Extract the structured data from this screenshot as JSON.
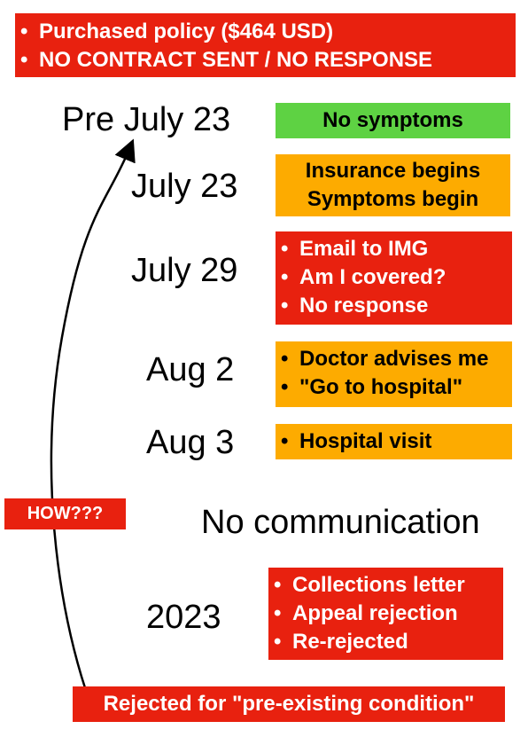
{
  "header_box": {
    "items": [
      "Purchased policy ($464 USD)",
      "NO CONTRACT SENT / NO RESPONSE"
    ]
  },
  "timeline": [
    {
      "date": "Pre July 23",
      "lines": [
        "No symptoms"
      ],
      "bullets": false,
      "color": "#5ed243"
    },
    {
      "date": "July 23",
      "lines": [
        "Insurance begins",
        "Symptoms begin"
      ],
      "bullets": false,
      "color": "#fdab00"
    },
    {
      "date": "July 29",
      "lines": [
        "Email to IMG",
        "Am I covered?",
        "No response"
      ],
      "bullets": true,
      "color": "#e8210f"
    },
    {
      "date": "Aug 2",
      "lines": [
        "Doctor advises me",
        "\"Go to hospital\""
      ],
      "bullets": true,
      "color": "#fdab00"
    },
    {
      "date": "Aug 3",
      "lines": [
        "Hospital visit"
      ],
      "bullets": true,
      "color": "#fdab00"
    },
    {
      "date": "2023",
      "lines": [
        "Collections letter",
        "Appeal rejection",
        "Re-rejected"
      ],
      "bullets": true,
      "color": "#e8210f"
    }
  ],
  "gap_label": "No communication",
  "how_label": "HOW???",
  "footer_label": "Rejected for \"pre-existing condition\"",
  "colors": {
    "red": "#e8210f",
    "orange": "#fdab00",
    "green": "#5ed243"
  }
}
